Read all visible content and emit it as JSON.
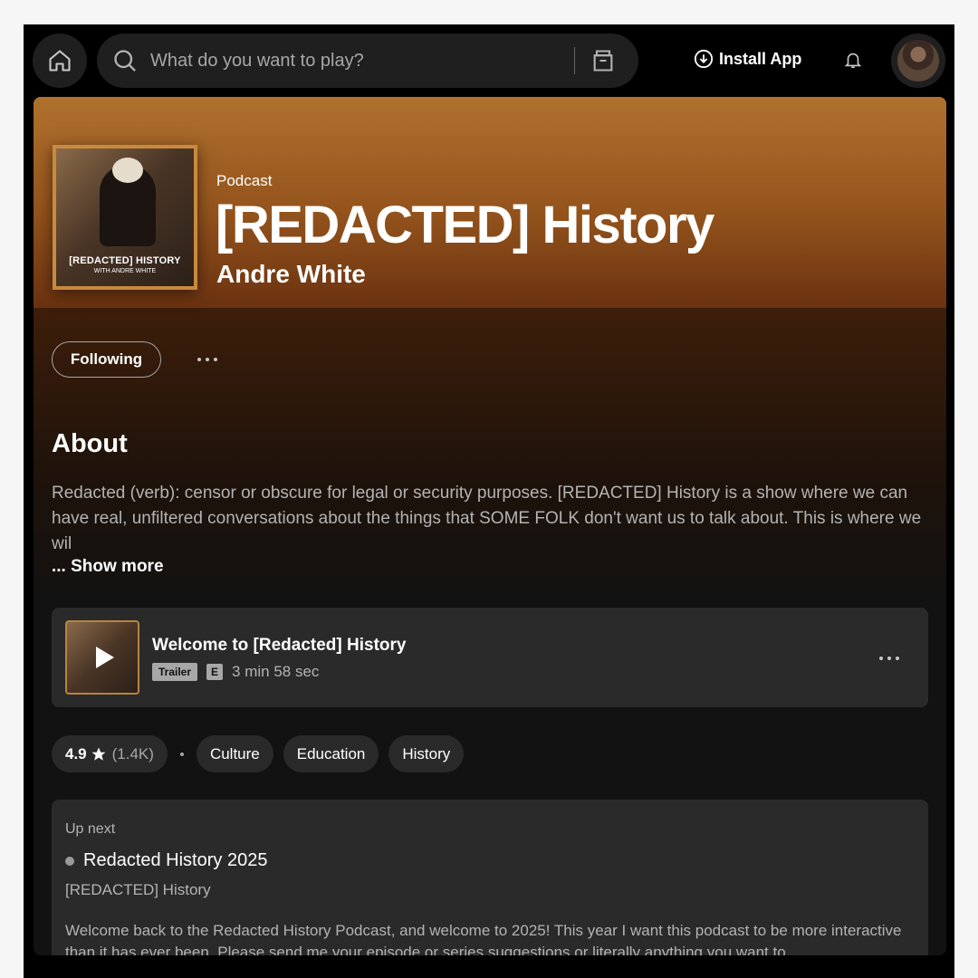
{
  "topbar": {
    "search_placeholder": "What do you want to play?",
    "install_label": "Install App"
  },
  "podcast": {
    "kind": "Podcast",
    "title": "[REDACTED] History",
    "author": "Andre White",
    "cover_title": "[REDACTED] HISTORY",
    "cover_subtitle": "WITH ANDRE WHITE"
  },
  "actions": {
    "follow_label": "Following"
  },
  "about": {
    "heading": "About",
    "text": "Redacted (verb): censor or obscure for legal or security purposes. [REDACTED] History is a show where we can have real, unfiltered conversations about the things that SOME FOLK don't want us to talk about. This is where we wil",
    "show_more": "... Show more"
  },
  "episode": {
    "title": "Welcome to [Redacted] History",
    "badge": "Trailer",
    "explicit": "E",
    "duration": "3 min 58 sec"
  },
  "rating": {
    "score": "4.9",
    "count": "(1.4K)"
  },
  "categories": [
    "Culture",
    "Education",
    "History"
  ],
  "up_next": {
    "label": "Up next",
    "title": "Redacted History 2025",
    "show": "[REDACTED] History",
    "description": "Welcome back to the Redacted History Podcast, and welcome to 2025! This year I want this podcast to be more interactive than it has ever been. Please send me your episode or series suggestions or literally anything you want to..."
  },
  "colors": {
    "header_top": "#b0712e",
    "header_bottom": "#6b3210",
    "surface": "#2a2a2a",
    "background": "#121212"
  },
  "icons": [
    "home-icon",
    "search-icon",
    "browse-icon",
    "download-icon",
    "bell-icon",
    "star-icon",
    "play-icon",
    "more-icon"
  ]
}
